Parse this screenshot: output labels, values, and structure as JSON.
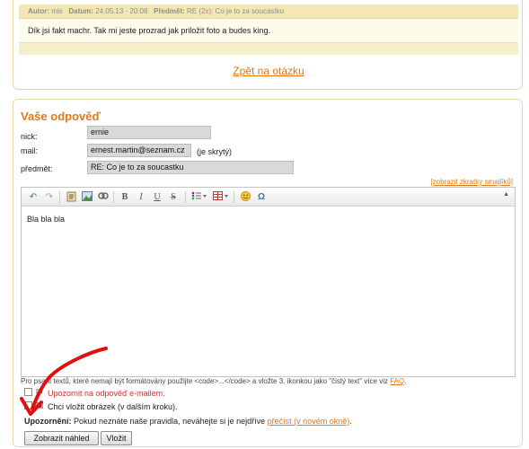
{
  "message": {
    "author_label": "Autor:",
    "author": "mis",
    "date_label": "Datum:",
    "date": "24.05.13 - 20:08",
    "subject_label": "Předmět:",
    "subject": "RE (2x): Co je to za soucastku",
    "body": "Dík jsi fakt machr. Tak mi jeste prozrad jak priložit foto a budes king."
  },
  "back_link": "Zpět na otázku",
  "answer": {
    "title": "Vaše odpověď",
    "nick_label": "nick:",
    "nick_value": "ernie",
    "mail_label": "mail:",
    "mail_value": "ernest.martin@seznam.cz",
    "mail_hint": "(je skrytý)",
    "subject_label": "předmět:",
    "subject_value": "RE: Co je to za soucastku",
    "smiley_link": "[zobrazit zkratky smajlíků]"
  },
  "editor": {
    "toolbar_icons": [
      "undo-icon",
      "redo-icon",
      "paste-text-icon",
      "image-icon",
      "link-icon",
      "bold-icon",
      "italic-icon",
      "underline-icon",
      "strikethrough-icon",
      "bulleted-list-icon",
      "table-icon",
      "smiley-icon",
      "special-char-icon"
    ],
    "toolbar_glyphs": {
      "bold": "B",
      "italic": "I",
      "underline": "U",
      "strike": "S",
      "omega": "Ω"
    },
    "content": "Bla bla bla"
  },
  "note": {
    "text": "Pro psaní textů, které nemají být formátovány použijte <code>...</code> a vložte 3. ikonkou jako \"čistý text\" více viz",
    "faq_link": "FAQ",
    "end": "."
  },
  "options": {
    "notify_label": "Upozornit na odpověď e-mailem.",
    "image_label": "Chci vložit obrázek (v dalším kroku)."
  },
  "warning": {
    "label": "Upozornění:",
    "text": "Pokud neznáte naše pravidla, neváhejte si je nejdříve",
    "link": "přečíst (v novém okně)",
    "end": "."
  },
  "buttons": {
    "preview": "Zobrazit náhled",
    "submit": "Vložit"
  },
  "colors": {
    "accent": "#e0781c",
    "panel_border": "#ead9a6",
    "meta_bar": "#f5e7b4",
    "annotation_arrow": "#e01010"
  }
}
